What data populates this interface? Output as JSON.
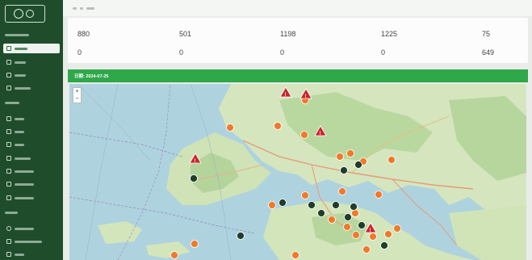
{
  "app": {
    "logo_text": ""
  },
  "sidebar": {
    "section_labels": [
      "",
      "",
      ""
    ],
    "items": [
      {
        "label": "",
        "icon": "grid-icon",
        "active": true
      },
      {
        "label": "",
        "icon": "monitor-icon",
        "active": false
      },
      {
        "label": "",
        "icon": "list-icon",
        "active": false
      },
      {
        "label": "",
        "icon": "location-icon",
        "active": false
      },
      {
        "label": "",
        "icon": "chart-icon",
        "active": false
      },
      {
        "label": "",
        "icon": "grid-icon",
        "active": false
      },
      {
        "label": "",
        "icon": "message-icon",
        "active": false
      },
      {
        "label": "",
        "icon": "file-icon",
        "active": false
      },
      {
        "label": "",
        "icon": "file-icon",
        "active": false
      },
      {
        "label": "",
        "icon": "file-icon",
        "active": false
      },
      {
        "label": "",
        "icon": "table-icon",
        "active": false
      },
      {
        "label": "",
        "icon": "clock-icon",
        "active": false
      },
      {
        "label": "",
        "icon": "users-icon",
        "active": false
      },
      {
        "label": "",
        "icon": "user-icon",
        "active": false
      }
    ]
  },
  "breadcrumb": {
    "items": [
      "",
      "",
      ""
    ]
  },
  "stats": [
    {
      "label": "",
      "value": "880"
    },
    {
      "label": "",
      "value": "501"
    },
    {
      "label": "",
      "value": "1198"
    },
    {
      "label": "",
      "value": "1225"
    },
    {
      "label": "",
      "value": "75"
    },
    {
      "label": "",
      "value": "0"
    },
    {
      "label": "",
      "value": "0"
    },
    {
      "label": "",
      "value": "0"
    },
    {
      "label": "",
      "value": "0"
    },
    {
      "label": "",
      "value": "649"
    }
  ],
  "banner": {
    "title": "日期: 2024-07-25"
  },
  "map": {
    "zoom_in": "+",
    "zoom_out": "−"
  },
  "colors": {
    "sidebar": "#1f4d2c",
    "banner": "#2fa84a",
    "marker_orange": "#f07a2a",
    "marker_red": "#c8262d",
    "marker_dark": "#1f3d2a"
  }
}
